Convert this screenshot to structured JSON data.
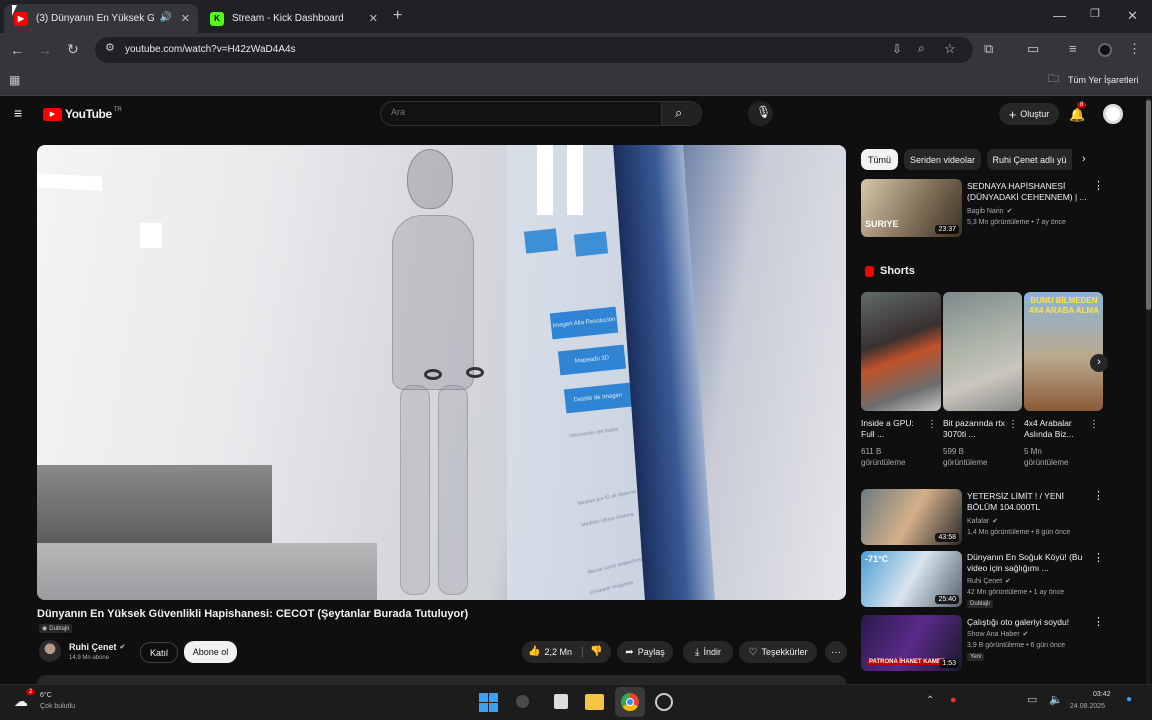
{
  "browser": {
    "tabs": [
      {
        "label": "(3) Dünyanın En Yüksek Gü",
        "active": true
      },
      {
        "label": "Stream - Kick Dashboard",
        "active": false
      }
    ],
    "new_tab": "+",
    "url": "youtube.com/watch?v=H42zWaD4A4s",
    "bookmarks_label": "Tüm Yer İşaretleri"
  },
  "youtube": {
    "logo_text": "YouTube",
    "country": "TR",
    "search_placeholder": "Ara",
    "create_label": "Oluştur",
    "notification_count": "8"
  },
  "video": {
    "title": "Dünyanın En Yüksek Güvenlikli Hapishanesi: CECOT (Şeytanlar Burada Tutuluyor)",
    "dubbed": "Dublajlı",
    "channel": "Ruhi Çenet",
    "subscribers": "14,9 Mn abone",
    "join_label": "Katıl",
    "subscribe_label": "Abone ol",
    "likes": "2,2 Mn",
    "share_label": "Paylaş",
    "download_label": "İndir",
    "thanks_label": "Teşekkürler",
    "more": "···",
    "screen_buttons": [
      "Imagen Alta Resolución",
      "Mapeado 3D",
      "Detalle de Imagen"
    ],
    "screen_text": [
      "Información del Sujeto",
      "Medidor por ID de Sistema",
      "Medidor Ultimo Sistema",
      "Marcar como sospechoso",
      "Compartir imágenes"
    ]
  },
  "sidebar": {
    "chips": [
      "Tümü",
      "Seriden videolar",
      "Ruhi Çenet adlı yü"
    ],
    "first_video": {
      "title": "SEDNAYA HAPİSHANESİ (DÜNYADAKİ CEHENNEM) | ...",
      "channel": "Bagib Narin",
      "meta": "5,3 Mn görüntüleme • 7 ay önce",
      "duration": "23:37",
      "thumb_text": "SURIYE"
    },
    "shorts_label": "Shorts",
    "shorts": [
      {
        "title": "Inside a GPU: Full ...",
        "views": "611 B görüntüleme"
      },
      {
        "title": "Bit pazarında rtx 3070ti ...",
        "views": "599 B görüntüleme",
        "thumb_text": ""
      },
      {
        "title": "4x4 Arabalar Aslında Biz...",
        "views": "5 Mn görüntüleme",
        "thumb_text": "BUNU BİLMEDEN 4X4 ARABA ALMA"
      }
    ],
    "videos": [
      {
        "title": "YETERSİZ LİMİT ! / YENİ BÖLÜM 104.000TL",
        "channel": "Kafalar",
        "meta": "1,4 Mn görüntüleme • 8 gün önce",
        "duration": "43:58",
        "badge": ""
      },
      {
        "title": "Dünyanın En Soğuk Köyü! (Bu video için sağlığımı ...",
        "channel": "Ruhi Çenet",
        "meta": "42 Mn görüntüleme • 1 ay önce",
        "duration": "25:40",
        "badge": "Dublajlı",
        "thumb_text": "-71°C"
      },
      {
        "title": "Çalıştığı oto galeriyi soydu!",
        "channel": "Show Ana Haber",
        "meta": "3,9 B görüntüleme • 6 gün önce",
        "duration": "1:53",
        "badge": "Yeni",
        "thumb_text": "PATRONA İHANET KAMER"
      }
    ]
  },
  "taskbar": {
    "weather_badge": "2",
    "weather_temp": "6°C",
    "weather_desc": "Çok bulutlu",
    "time": "03:42",
    "date": "24.08.2025"
  }
}
